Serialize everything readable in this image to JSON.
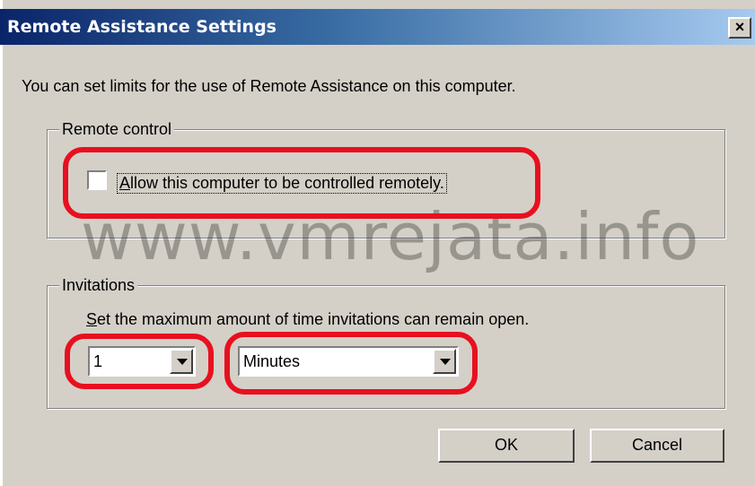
{
  "window": {
    "title": "Remote Assistance Settings",
    "close_glyph": "×"
  },
  "intro_text": "You can set limits for the use of Remote Assistance on this computer.",
  "remote_control": {
    "group_label": "Remote control",
    "checkbox_label": "Allow this computer to be controlled remotely.",
    "checked": false
  },
  "invitations": {
    "group_label": "Invitations",
    "description": "Set the maximum amount of time invitations can remain open.",
    "amount_value": "1",
    "unit_value": "Minutes"
  },
  "buttons": {
    "ok_label": "OK",
    "cancel_label": "Cancel"
  },
  "watermark": "www.vmrejata.info",
  "colors": {
    "highlight": "#e8101f",
    "titlebar_start": "#0a246a",
    "titlebar_end": "#a6caf0",
    "dialog_bg": "#d4d0c8"
  }
}
